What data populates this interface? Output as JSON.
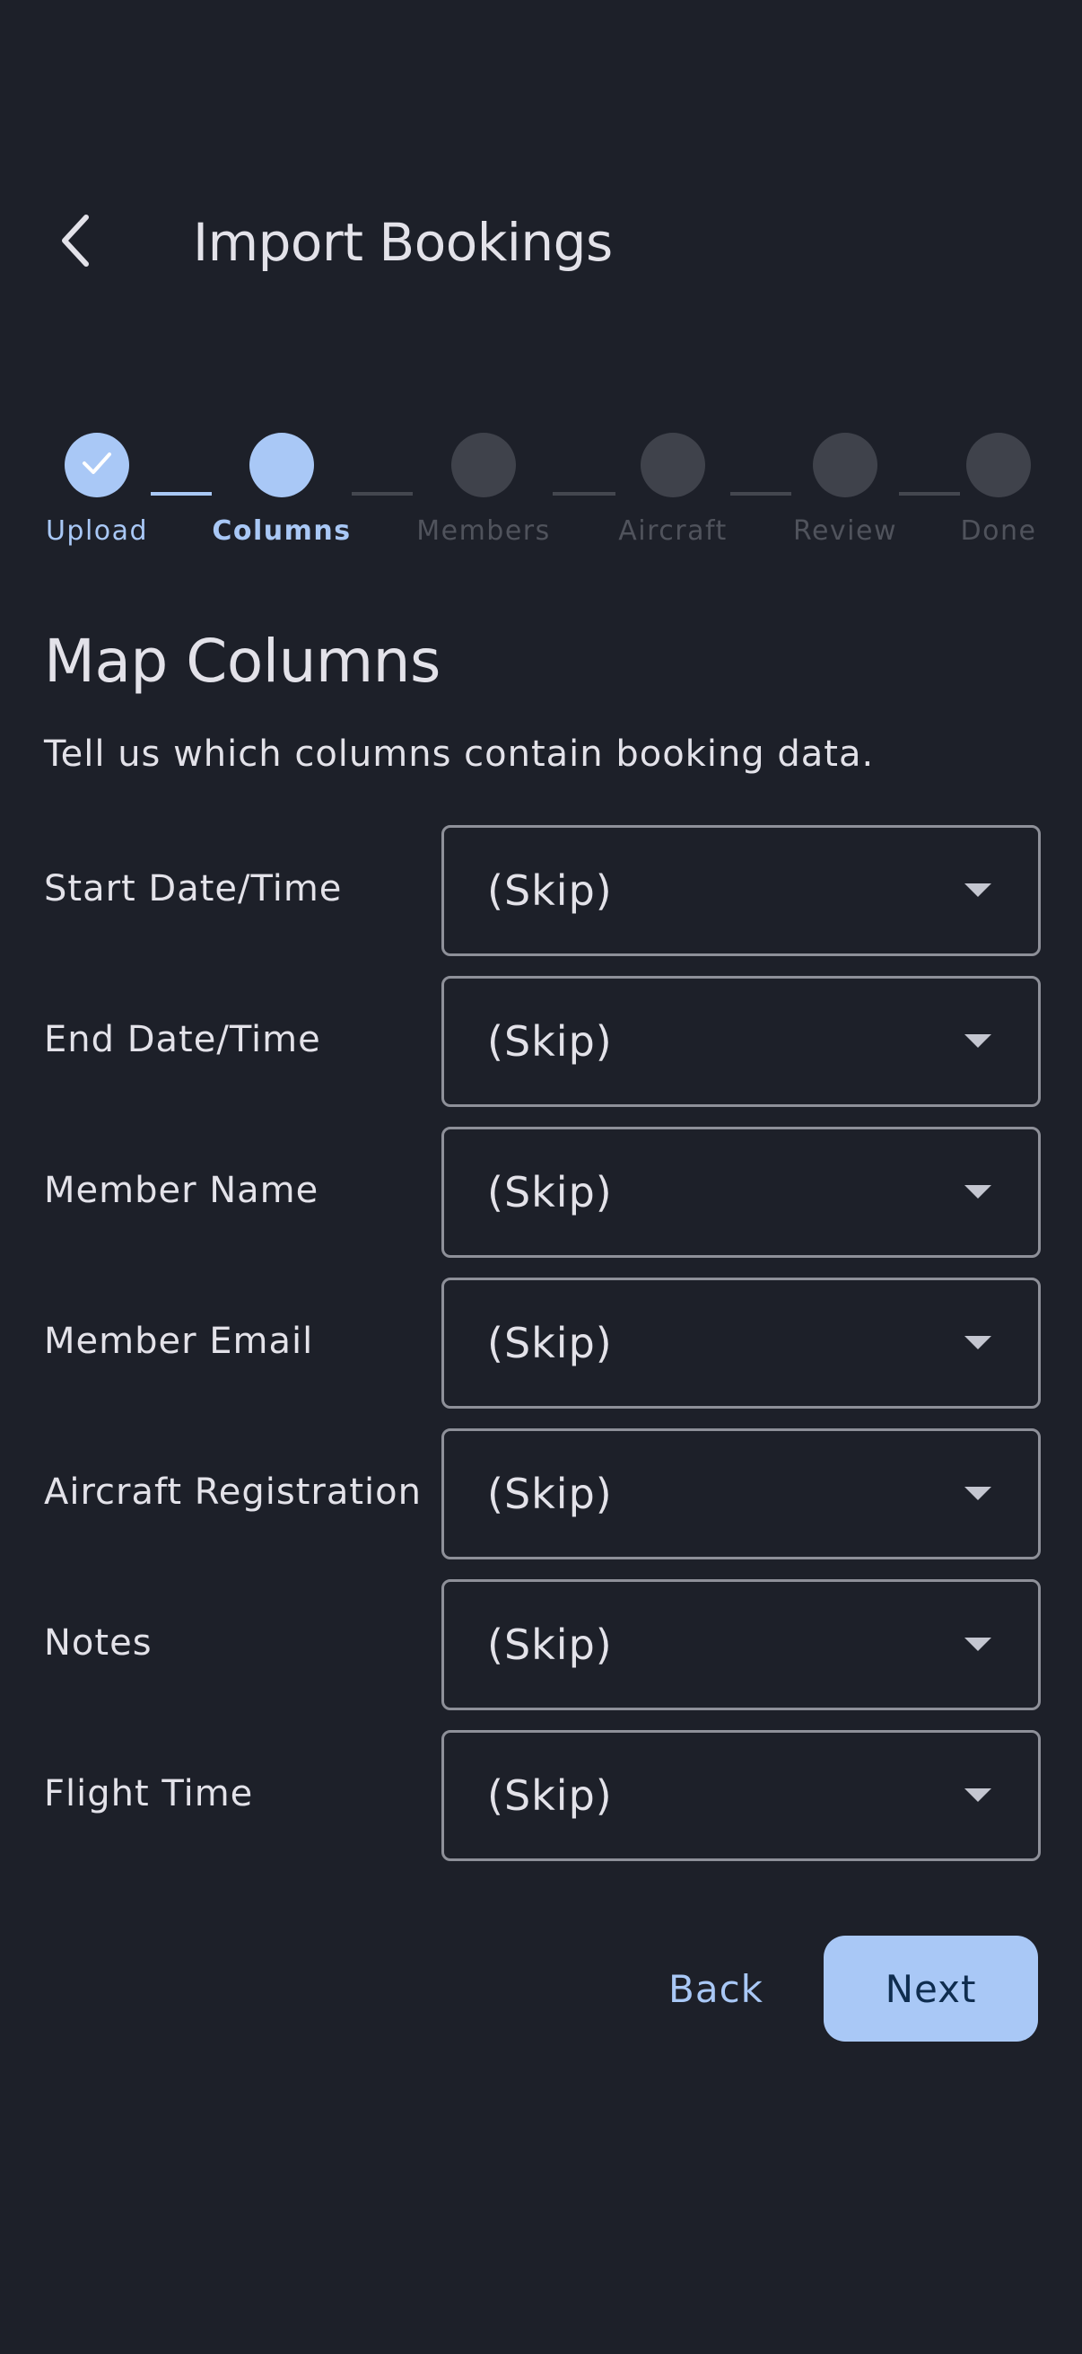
{
  "header": {
    "back_icon": "chevron-left-icon",
    "title": "Import Bookings"
  },
  "stepper": {
    "current_step": 2,
    "steps": [
      {
        "label": "Upload",
        "state": "done",
        "icon": "check-icon"
      },
      {
        "label": "Columns",
        "state": "active"
      },
      {
        "label": "Members",
        "state": "pending"
      },
      {
        "label": "Aircraft",
        "state": "pending"
      },
      {
        "label": "Review",
        "state": "pending"
      },
      {
        "label": "Done",
        "state": "pending"
      }
    ]
  },
  "section": {
    "title": "Map Columns",
    "description": "Tell us which columns contain booking data."
  },
  "mappings": [
    {
      "label": "Start Date/Time",
      "value": "(Skip)"
    },
    {
      "label": "End Date/Time",
      "value": "(Skip)"
    },
    {
      "label": "Member Name",
      "value": "(Skip)"
    },
    {
      "label": "Member Email",
      "value": "(Skip)"
    },
    {
      "label": "Aircraft Registration",
      "value": "(Skip)"
    },
    {
      "label": "Notes",
      "value": "(Skip)"
    },
    {
      "label": "Flight Time",
      "value": "(Skip)"
    }
  ],
  "actions": {
    "back_label": "Back",
    "next_label": "Next"
  },
  "colors": {
    "background": "#1d2029",
    "accent": "#a9c8f6",
    "inactive_step": "#3f424b",
    "outline": "#8e9099",
    "text": "#e3e2e9"
  }
}
